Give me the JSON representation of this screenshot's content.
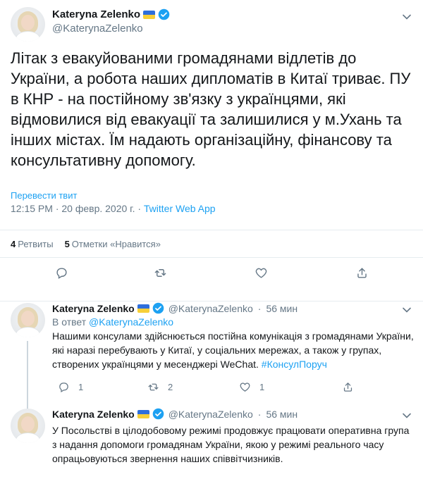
{
  "main_tweet": {
    "author_name": "Kateryna Zelenko",
    "author_handle": "@KaterynaZelenko",
    "text": "Літак з евакуйованими громадянами відлетів до України, а робота наших дипломатів в Китаї триває. ПУ в КНР - на постійному зв'язку з українцями, які відмовилися від евакуації та залишилися у м.Ухань та інших містах. Їм надають організаційну, фінансову та консультативну   допомогу.",
    "translate_label": "Перевести твит",
    "timestamp": "12:15 PM · 20 февр. 2020 г. · ",
    "source": "Twitter Web App",
    "retweets_count": "4",
    "retweets_label": "Ретвиты",
    "likes_count": "5",
    "likes_label": "Отметки «Нравится»"
  },
  "replies": [
    {
      "author_name": "Kateryna Zelenko",
      "author_handle": "@KaterynaZelenko",
      "time": "56 мин",
      "in_reply_prefix": "В ответ",
      "in_reply_handle": "@KaterynaZelenko",
      "text": "Нашими консулами здійснюється постійна комунікація з громадянами України, які наразі перебувають у Китаї, у соціальних мережах, а також у групах, створених українцями у месенджері WeChat.",
      "hashtag": "#КонсулПоруч",
      "reply_count": "1",
      "retweet_count": "2",
      "like_count": "1"
    },
    {
      "author_name": "Kateryna Zelenko",
      "author_handle": "@KaterynaZelenko",
      "time": "56 мин",
      "text": "У Посольстві в цілодобовому режимі продовжує працювати оперативна група з надання допомоги громадянам України, якою у режимі реального часу опрацьовуються звернення наших співвітчизників."
    }
  ],
  "colors": {
    "accent": "#1da1f2",
    "muted": "#657786",
    "text": "#14171a",
    "border": "#e6ecf0"
  },
  "icons": [
    "avatar",
    "ukraine-flag-icon",
    "verified-badge-icon",
    "chevron-down-icon",
    "reply-icon",
    "retweet-icon",
    "like-icon",
    "share-icon"
  ]
}
